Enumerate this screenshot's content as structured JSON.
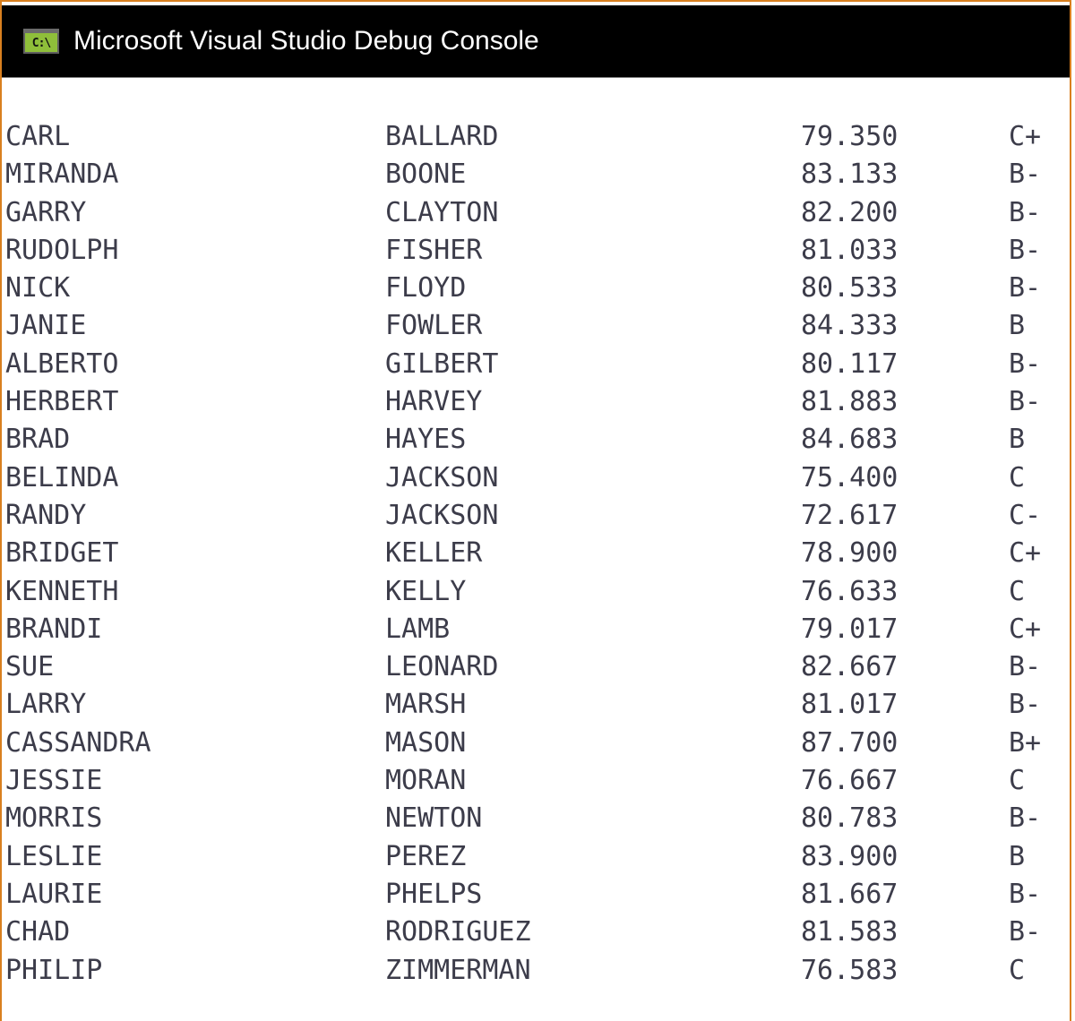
{
  "window": {
    "title": "Microsoft Visual Studio Debug Console",
    "icon": "console-app-icon",
    "icon_glyph": "C:\\",
    "border_color": "#d9801f",
    "titlebar_color": "#000000",
    "icon_color": "#8fbf3a"
  },
  "console": {
    "text_color": "#3c3c4a",
    "background": "#ffffff",
    "rows": [
      {
        "first": "CARL",
        "last": "BALLARD",
        "average": "79.350",
        "grade": "C+"
      },
      {
        "first": "MIRANDA",
        "last": "BOONE",
        "average": "83.133",
        "grade": "B-"
      },
      {
        "first": "GARRY",
        "last": "CLAYTON",
        "average": "82.200",
        "grade": "B-"
      },
      {
        "first": "RUDOLPH",
        "last": "FISHER",
        "average": "81.033",
        "grade": "B-"
      },
      {
        "first": "NICK",
        "last": "FLOYD",
        "average": "80.533",
        "grade": "B-"
      },
      {
        "first": "JANIE",
        "last": "FOWLER",
        "average": "84.333",
        "grade": "B"
      },
      {
        "first": "ALBERTO",
        "last": "GILBERT",
        "average": "80.117",
        "grade": "B-"
      },
      {
        "first": "HERBERT",
        "last": "HARVEY",
        "average": "81.883",
        "grade": "B-"
      },
      {
        "first": "BRAD",
        "last": "HAYES",
        "average": "84.683",
        "grade": "B"
      },
      {
        "first": "BELINDA",
        "last": "JACKSON",
        "average": "75.400",
        "grade": "C"
      },
      {
        "first": "RANDY",
        "last": "JACKSON",
        "average": "72.617",
        "grade": "C-"
      },
      {
        "first": "BRIDGET",
        "last": "KELLER",
        "average": "78.900",
        "grade": "C+"
      },
      {
        "first": "KENNETH",
        "last": "KELLY",
        "average": "76.633",
        "grade": "C"
      },
      {
        "first": "BRANDI",
        "last": "LAMB",
        "average": "79.017",
        "grade": "C+"
      },
      {
        "first": "SUE",
        "last": "LEONARD",
        "average": "82.667",
        "grade": "B-"
      },
      {
        "first": "LARRY",
        "last": "MARSH",
        "average": "81.017",
        "grade": "B-"
      },
      {
        "first": "CASSANDRA",
        "last": "MASON",
        "average": "87.700",
        "grade": "B+"
      },
      {
        "first": "JESSIE",
        "last": "MORAN",
        "average": "76.667",
        "grade": "C"
      },
      {
        "first": "MORRIS",
        "last": "NEWTON",
        "average": "80.783",
        "grade": "B-"
      },
      {
        "first": "LESLIE",
        "last": "PEREZ",
        "average": "83.900",
        "grade": "B"
      },
      {
        "first": "LAURIE",
        "last": "PHELPS",
        "average": "81.667",
        "grade": "B-"
      },
      {
        "first": "CHAD",
        "last": "RODRIGUEZ",
        "average": "81.583",
        "grade": "B-"
      },
      {
        "first": "PHILIP",
        "last": "ZIMMERMAN",
        "average": "76.583",
        "grade": "C"
      }
    ]
  }
}
